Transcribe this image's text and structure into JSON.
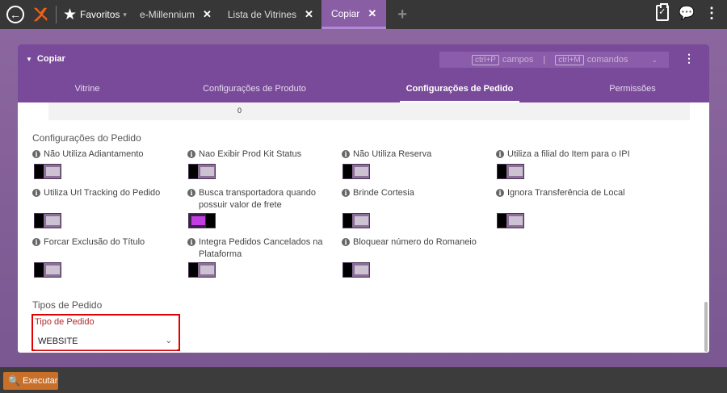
{
  "topbar": {
    "favorites_label": "Favoritos",
    "tabs": [
      {
        "label": "e-Millennium"
      },
      {
        "label": "Lista de Vitrines"
      },
      {
        "label": "Copiar"
      }
    ]
  },
  "panel": {
    "title": "Copiar",
    "hints": {
      "fields_key": "ctrl+P",
      "fields_label": "campos",
      "separator": "|",
      "commands_key": "ctrl+M",
      "commands_label": "comandos"
    },
    "subtabs": [
      {
        "label": "Vitrine"
      },
      {
        "label": "Configurações de Produto"
      },
      {
        "label": "Configurações de Pedido"
      },
      {
        "label": "Permissões"
      }
    ],
    "stub_value": "0",
    "order_settings": {
      "title": "Configurações do Pedido",
      "options": [
        {
          "label": "Não Utiliza Adiantamento",
          "on": false
        },
        {
          "label": "Nao Exibir Prod Kit Status",
          "on": false
        },
        {
          "label": "Não Utiliza Reserva",
          "on": false
        },
        {
          "label": "Utiliza a filial do Item para o IPI",
          "on": false
        },
        {
          "label": "Utiliza Url Tracking do Pedido",
          "on": false
        },
        {
          "label": "Busca transportadora quando possuir valor de frete",
          "on": true
        },
        {
          "label": "Brinde Cortesia",
          "on": false
        },
        {
          "label": "Ignora Transferência de Local",
          "on": false
        },
        {
          "label": "Forcar Exclusão do Título",
          "on": false
        },
        {
          "label": "Integra Pedidos Cancelados na Plataforma",
          "on": false
        },
        {
          "label": "Bloquear número do Romaneio",
          "on": false
        }
      ]
    },
    "order_types": {
      "title": "Tipos de Pedido",
      "field_label": "Tipo de Pedido",
      "selected": "WEBSITE"
    }
  },
  "footer": {
    "run_label": "Executar"
  },
  "colors": {
    "accent": "#7a4a9a",
    "toggle_on": "#c33ee0",
    "run_button": "#c8702a",
    "highlight": "#e00000"
  }
}
